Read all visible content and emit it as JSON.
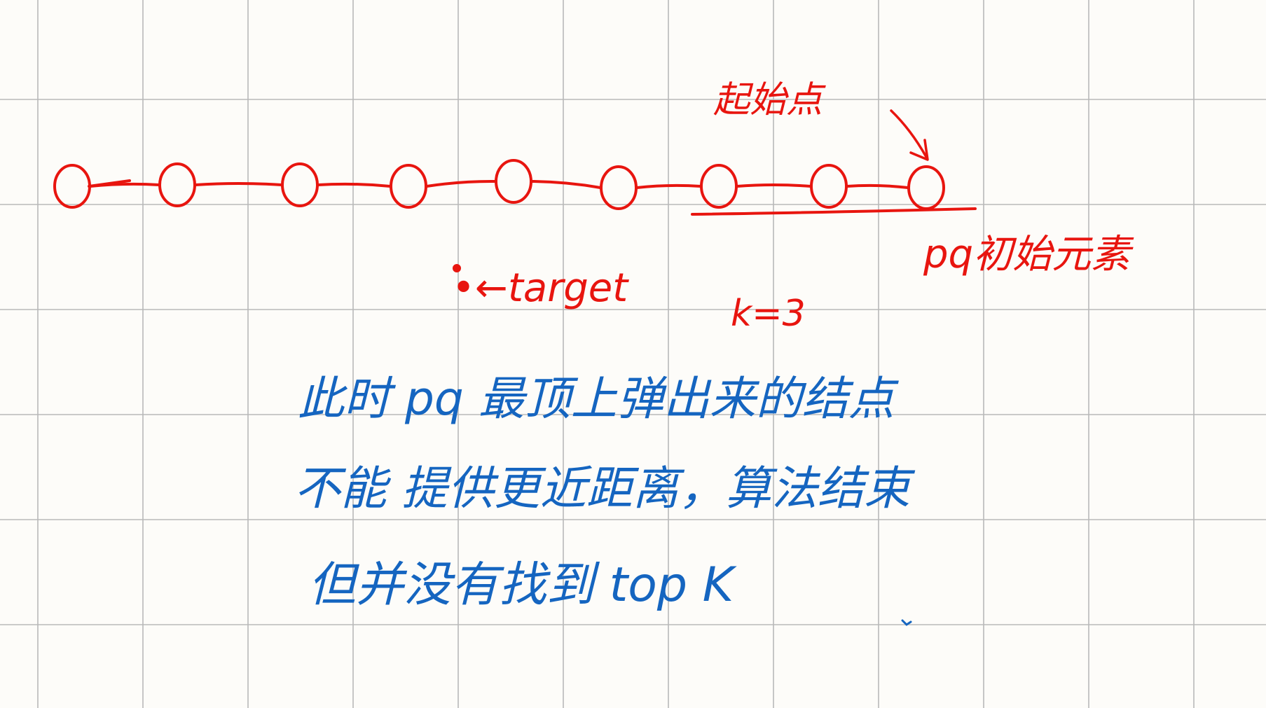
{
  "colors": {
    "background": "#fdfcf9",
    "grid": "#b9b9b9",
    "red_ink": "#e8150f",
    "blue_ink": "#1565c0"
  },
  "diagram": {
    "node_count": 9,
    "labels": {
      "start_point": "起始点",
      "pq_initial": "pq初始元素",
      "target": "•←target",
      "k_value": "k=3"
    }
  },
  "note": {
    "line1": "此时 pq 最顶上弹出来的结点",
    "line2": "不能 提供更近距离，算法结束",
    "line3": "但并没有找到 top K"
  }
}
